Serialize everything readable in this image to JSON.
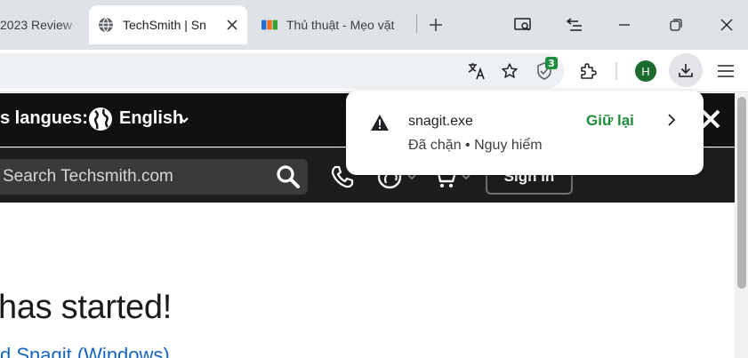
{
  "browser": {
    "tabs": [
      {
        "title": "2023 Review",
        "icon": "none"
      },
      {
        "title": "TechSmith | Sn",
        "icon": "globe-icon",
        "active": true
      },
      {
        "title": "Thủ thuật - Mẹo vặt",
        "icon": "fpt-logo-icon"
      }
    ],
    "extension_badge": "3",
    "profile_initial": "H",
    "colors": {
      "tabstrip": "#dfe3e8",
      "profile": "#1e6b2f",
      "badge": "#1e8e3e"
    }
  },
  "page": {
    "language_label": "s langues:",
    "language_value": "English",
    "search_placeholder": "Search Techsmith.com",
    "signin_label": "Sign in",
    "headline": "has started!",
    "link_text": "d Snagit (Windows)",
    "colors": {
      "topbar": "#111111",
      "navbar": "#1d1d1d",
      "link": "#1565c0"
    }
  },
  "download_bubble": {
    "filename": "snagit.exe",
    "status": "Đã chặn • Nguy hiểm",
    "keep_label": "Giữ lại",
    "colors": {
      "keep": "#1e8e3e"
    }
  }
}
